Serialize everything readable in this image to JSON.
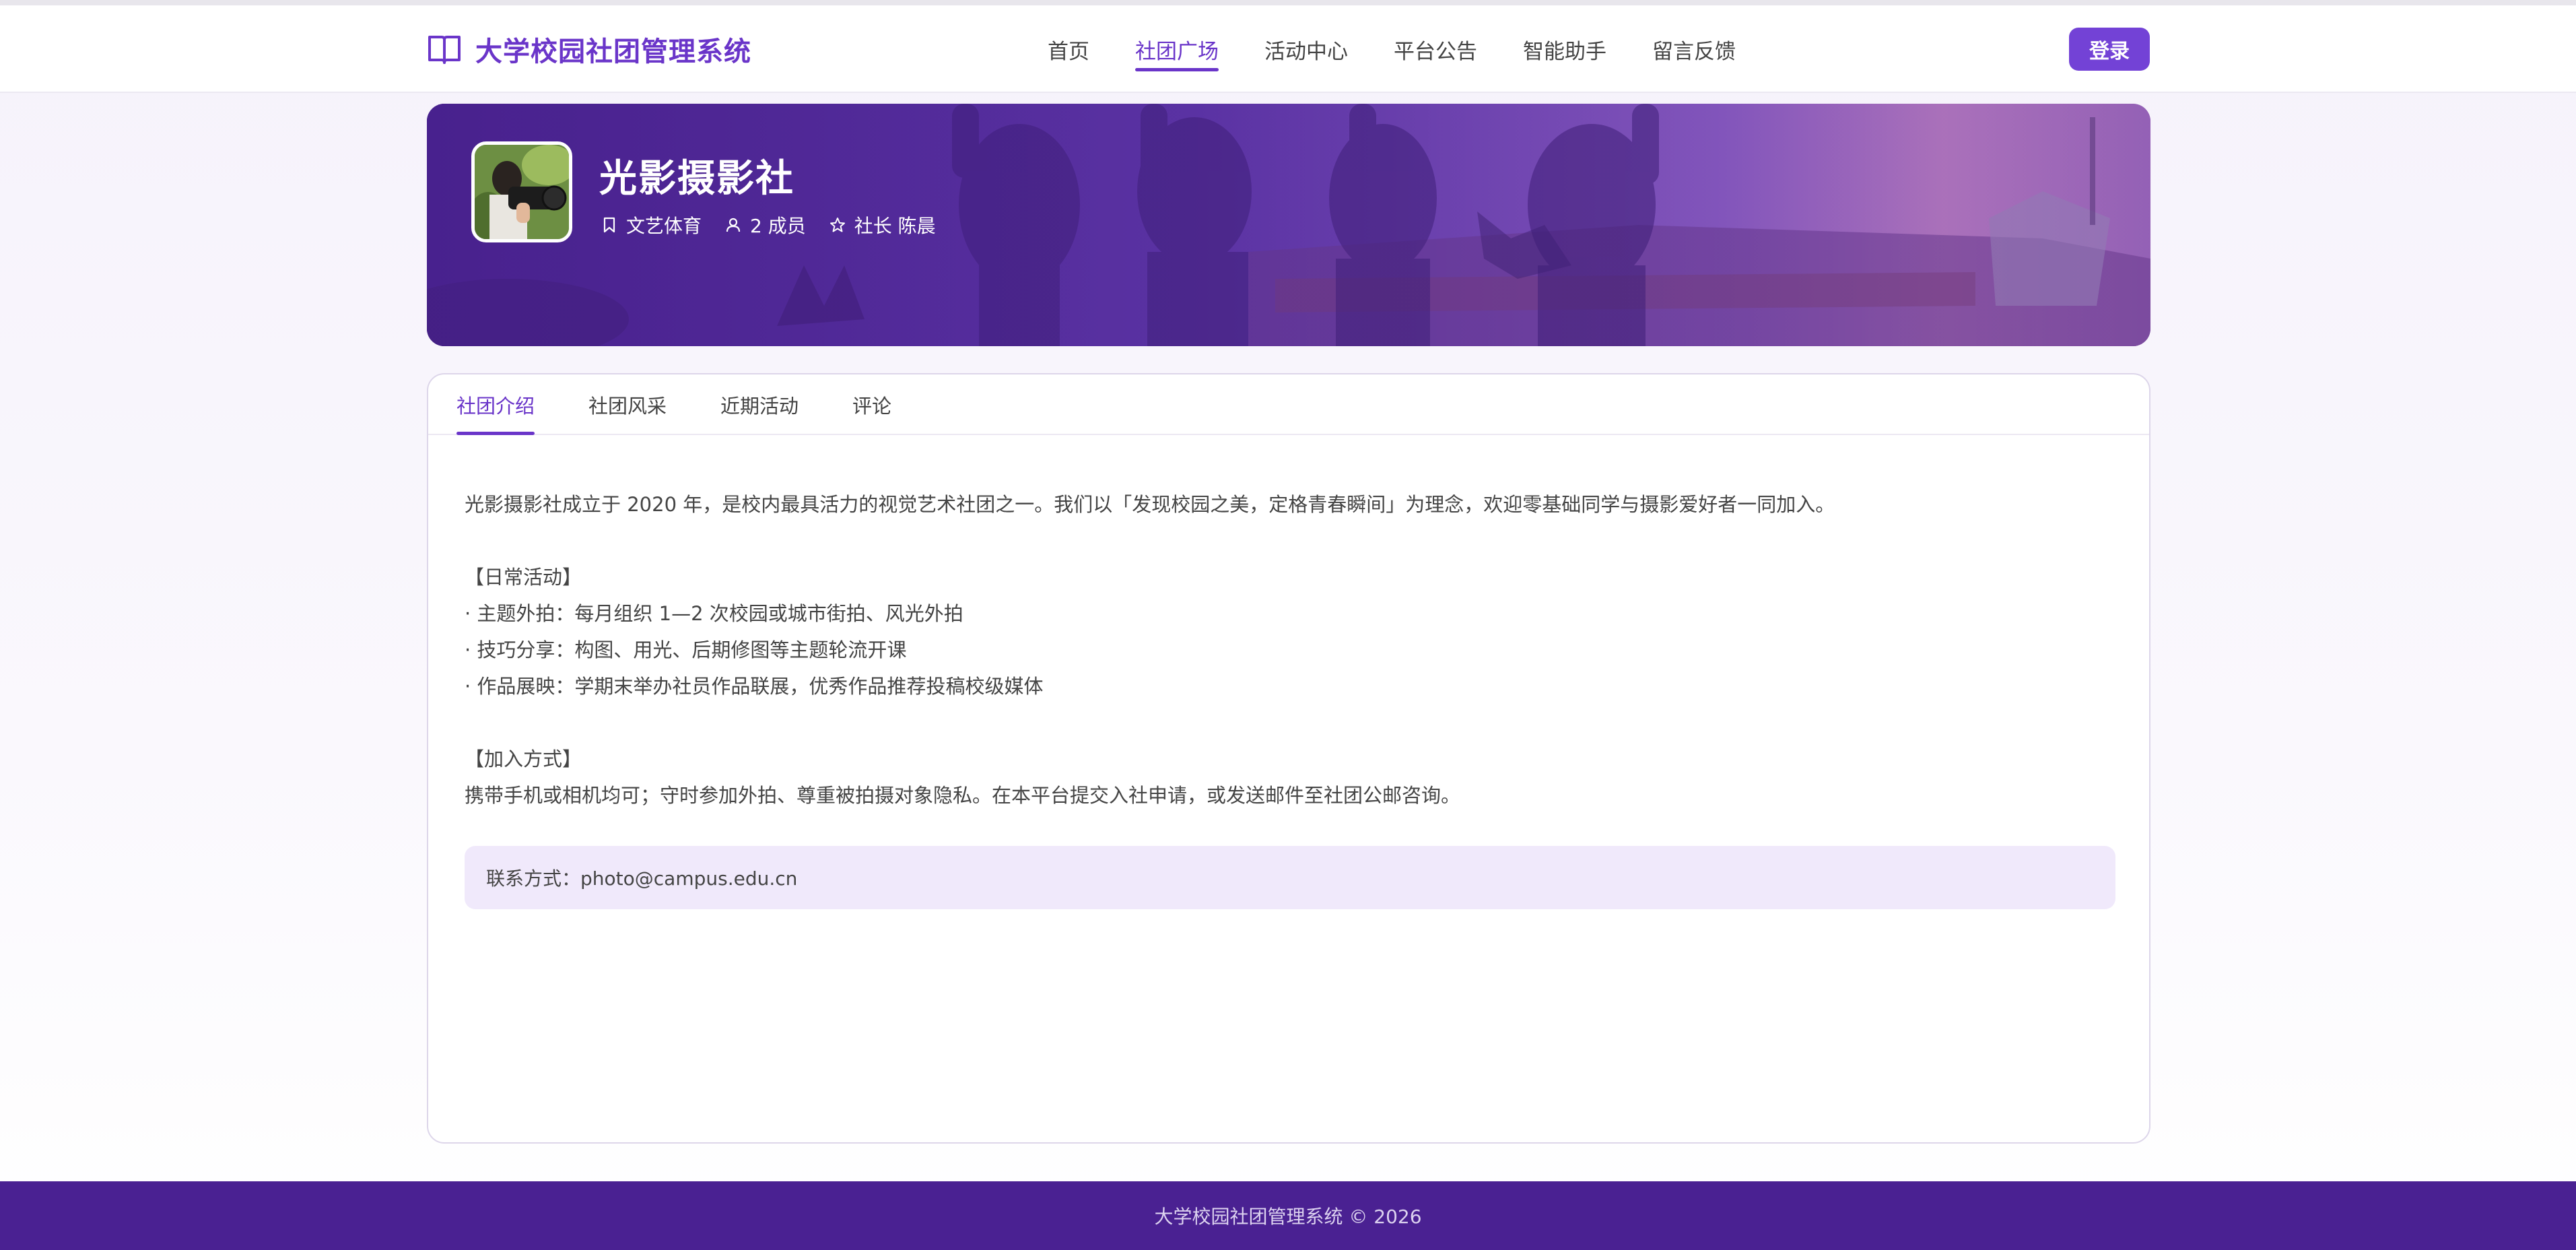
{
  "header": {
    "brand_icon": "open-book-icon",
    "brand_title": "大学校园社团管理系统",
    "nav": [
      {
        "label": "首页",
        "active": false
      },
      {
        "label": "社团广场",
        "active": true
      },
      {
        "label": "活动中心",
        "active": false
      },
      {
        "label": "平台公告",
        "active": false
      },
      {
        "label": "智能助手",
        "active": false
      },
      {
        "label": "留言反馈",
        "active": false
      }
    ],
    "login_label": "登录"
  },
  "club": {
    "name": "光影摄影社",
    "category": "文艺体育",
    "members": "2 成员",
    "leader": "社长 陈晨"
  },
  "tabs": [
    {
      "label": "社团介绍",
      "active": true
    },
    {
      "label": "社团风采",
      "active": false
    },
    {
      "label": "近期活动",
      "active": false
    },
    {
      "label": "评论",
      "active": false
    }
  ],
  "intro": {
    "paragraph1": "光影摄影社成立于 2020 年，是校内最具活力的视觉艺术社团之一。我们以「发现校园之美，定格青春瞬间」为理念，欢迎零基础同学与摄影爱好者一同加入。",
    "daily_heading": "【日常活动】",
    "daily_items": [
      "· 主题外拍：每月组织 1—2 次校园或城市街拍、风光外拍",
      "· 技巧分享：构图、用光、后期修图等主题轮流开课",
      "· 作品展映：学期末举办社员作品联展，优秀作品推荐投稿校级媒体"
    ],
    "join_heading": "【加入方式】",
    "join_text": "携带手机或相机均可；守时参加外拍、尊重被拍摄对象隐私。在本平台提交入社申请，或发送邮件至社团公邮咨询。",
    "contact": "联系方式：photo@campus.edu.cn"
  },
  "footer": {
    "text": "大学校园社团管理系统 © 2026"
  },
  "colors": {
    "accent": "#6a35c9",
    "footer_bg": "#4a2192",
    "contact_bg": "#f0e9fb"
  }
}
